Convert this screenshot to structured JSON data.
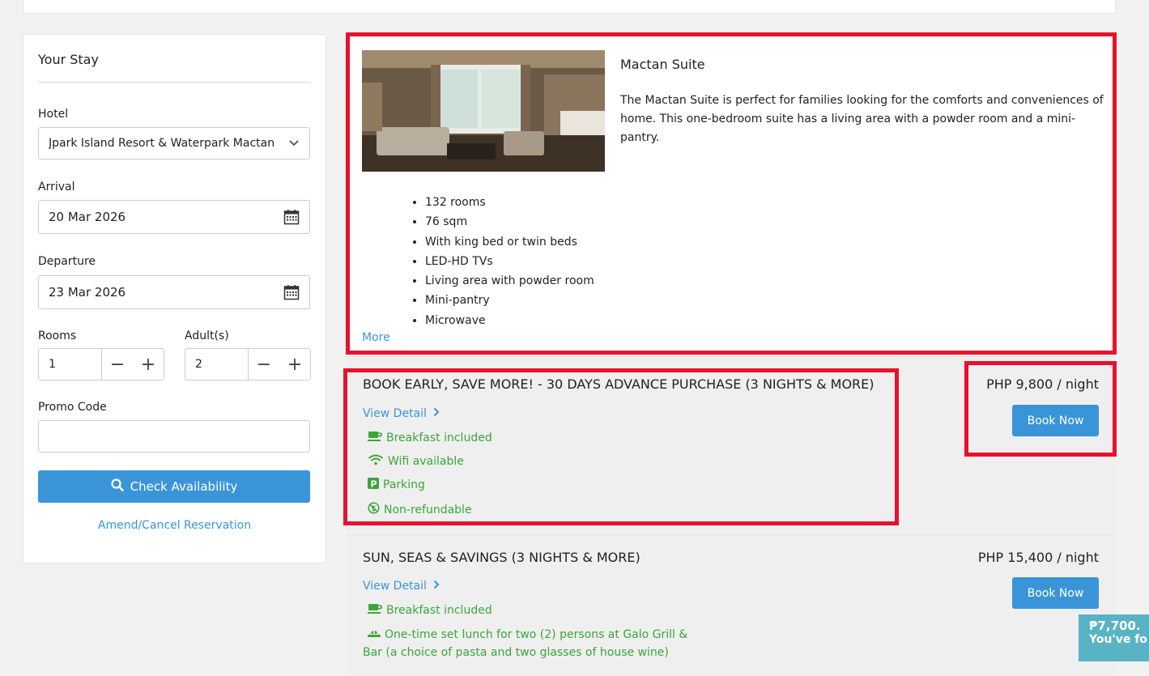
{
  "sidebar": {
    "title": "Your Stay",
    "hotel_label": "Hotel",
    "hotel_value": "Jpark Island Resort & Waterpark Mactan",
    "arrival_label": "Arrival",
    "arrival_value": "20 Mar 2026",
    "departure_label": "Departure",
    "departure_value": "23 Mar 2026",
    "rooms_label": "Rooms",
    "rooms_value": "1",
    "adults_label": "Adult(s)",
    "adults_value": "2",
    "promo_label": "Promo Code",
    "promo_value": "",
    "check_button": "Check Availability",
    "amend_link": "Amend/Cancel Reservation",
    "minus": "−",
    "plus": "+"
  },
  "room": {
    "name": "Mactan Suite",
    "description": "The Mactan Suite is perfect for families looking for the comforts and conveniences of home. This one-bedroom suite has a living area with a powder room and a mini-pantry.",
    "amenities": [
      "132 rooms",
      "76 sqm",
      "With king bed or twin beds",
      "LED-HD TVs",
      "Living area with powder room",
      "Mini-pantry",
      "Microwave"
    ],
    "more_link": "More"
  },
  "rates": [
    {
      "title": "BOOK EARLY, SAVE MORE! - 30 DAYS ADVANCE PURCHASE (3 NIGHTS & MORE)",
      "view_detail": "View Detail",
      "price": "PHP 9,800 / night",
      "book": "Book Now",
      "features": [
        {
          "icon": "coffee-cup-icon",
          "label": "Breakfast included"
        },
        {
          "icon": "wifi-icon",
          "label": "Wifi available"
        },
        {
          "icon": "parking-icon",
          "label": "Parking"
        },
        {
          "icon": "non-refundable-icon",
          "label": "Non-refundable"
        }
      ]
    },
    {
      "title": "SUN, SEAS & SAVINGS (3 NIGHTS & MORE)",
      "view_detail": "View Detail",
      "price": "PHP 15,400 / night",
      "book": "Book Now",
      "features": [
        {
          "icon": "coffee-cup-icon",
          "label": "Breakfast included"
        },
        {
          "icon": "meal-icon",
          "label": "One-time set lunch for two (2) persons at Galo Grill &"
        },
        {
          "icon": "",
          "label": "Bar (a choice of pasta and two glasses of house wine)"
        }
      ]
    }
  ],
  "toast": {
    "line1": "₱7,700.",
    "line2": "You've fo"
  },
  "colors": {
    "accent": "#3a95d8",
    "highlight": "#e8112d",
    "feature_green": "#3aa63a"
  }
}
